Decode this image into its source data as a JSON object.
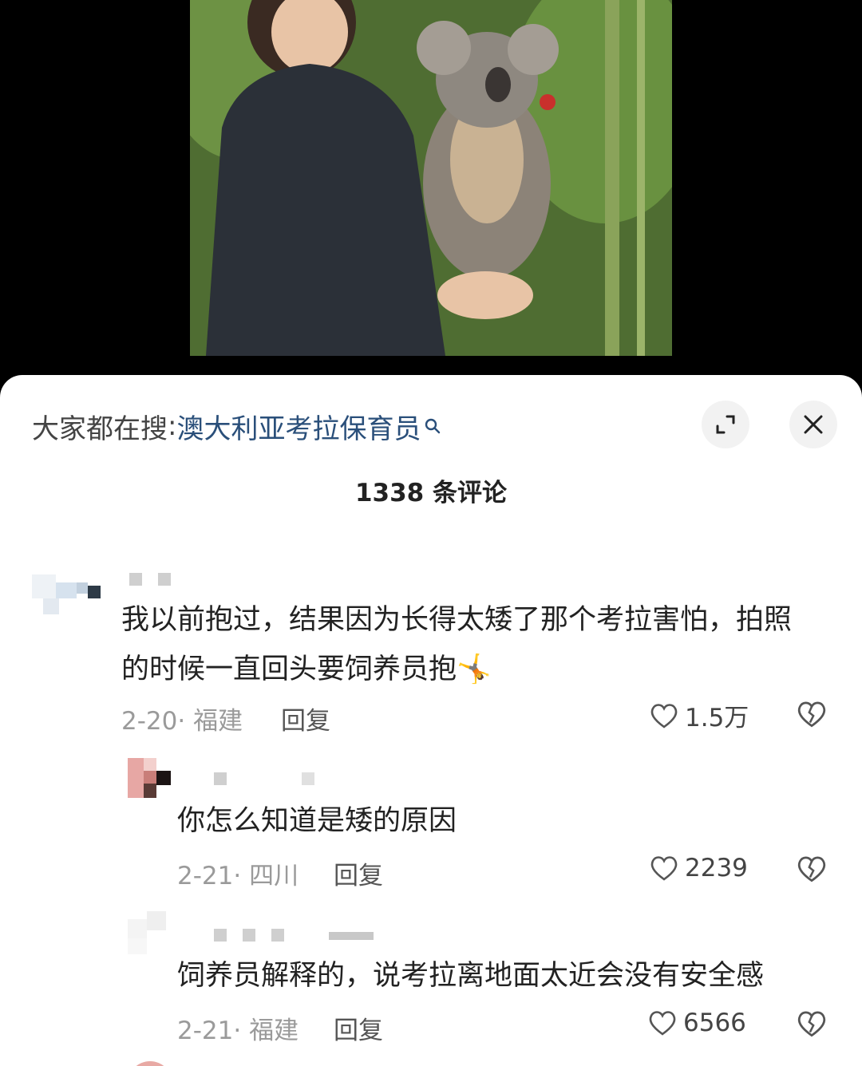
{
  "search": {
    "prefix": "大家都在搜",
    "colon": ":",
    "term": "澳大利亚考拉保育员"
  },
  "comment_count": "1338 条评论",
  "comments": [
    {
      "text_line1": "我以前抱过，结果因为长得太矮了那个考拉害怕，拍照",
      "text_line2": "的时候一直回头要饲养员抱",
      "emoji": "🤸",
      "date": "2-20",
      "location": "福建",
      "reply_label": "回复",
      "likes": "1.5万"
    },
    {
      "text": "你怎么知道是矮的原因",
      "date": "2-21",
      "location": "四川",
      "reply_label": "回复",
      "likes": "2239"
    },
    {
      "text": "饲养员解释的，说考拉离地面太近会没有安全感",
      "date": "2-21",
      "location": "福建",
      "reply_label": "回复",
      "likes": "6566"
    }
  ],
  "colors": {
    "search_term": "#2a4f7a",
    "meta": "#9a9a9a",
    "sheet_bg": "#ffffff"
  },
  "icons": [
    "search-icon",
    "expand-icon",
    "close-icon",
    "heart-icon",
    "broken-heart-icon"
  ]
}
